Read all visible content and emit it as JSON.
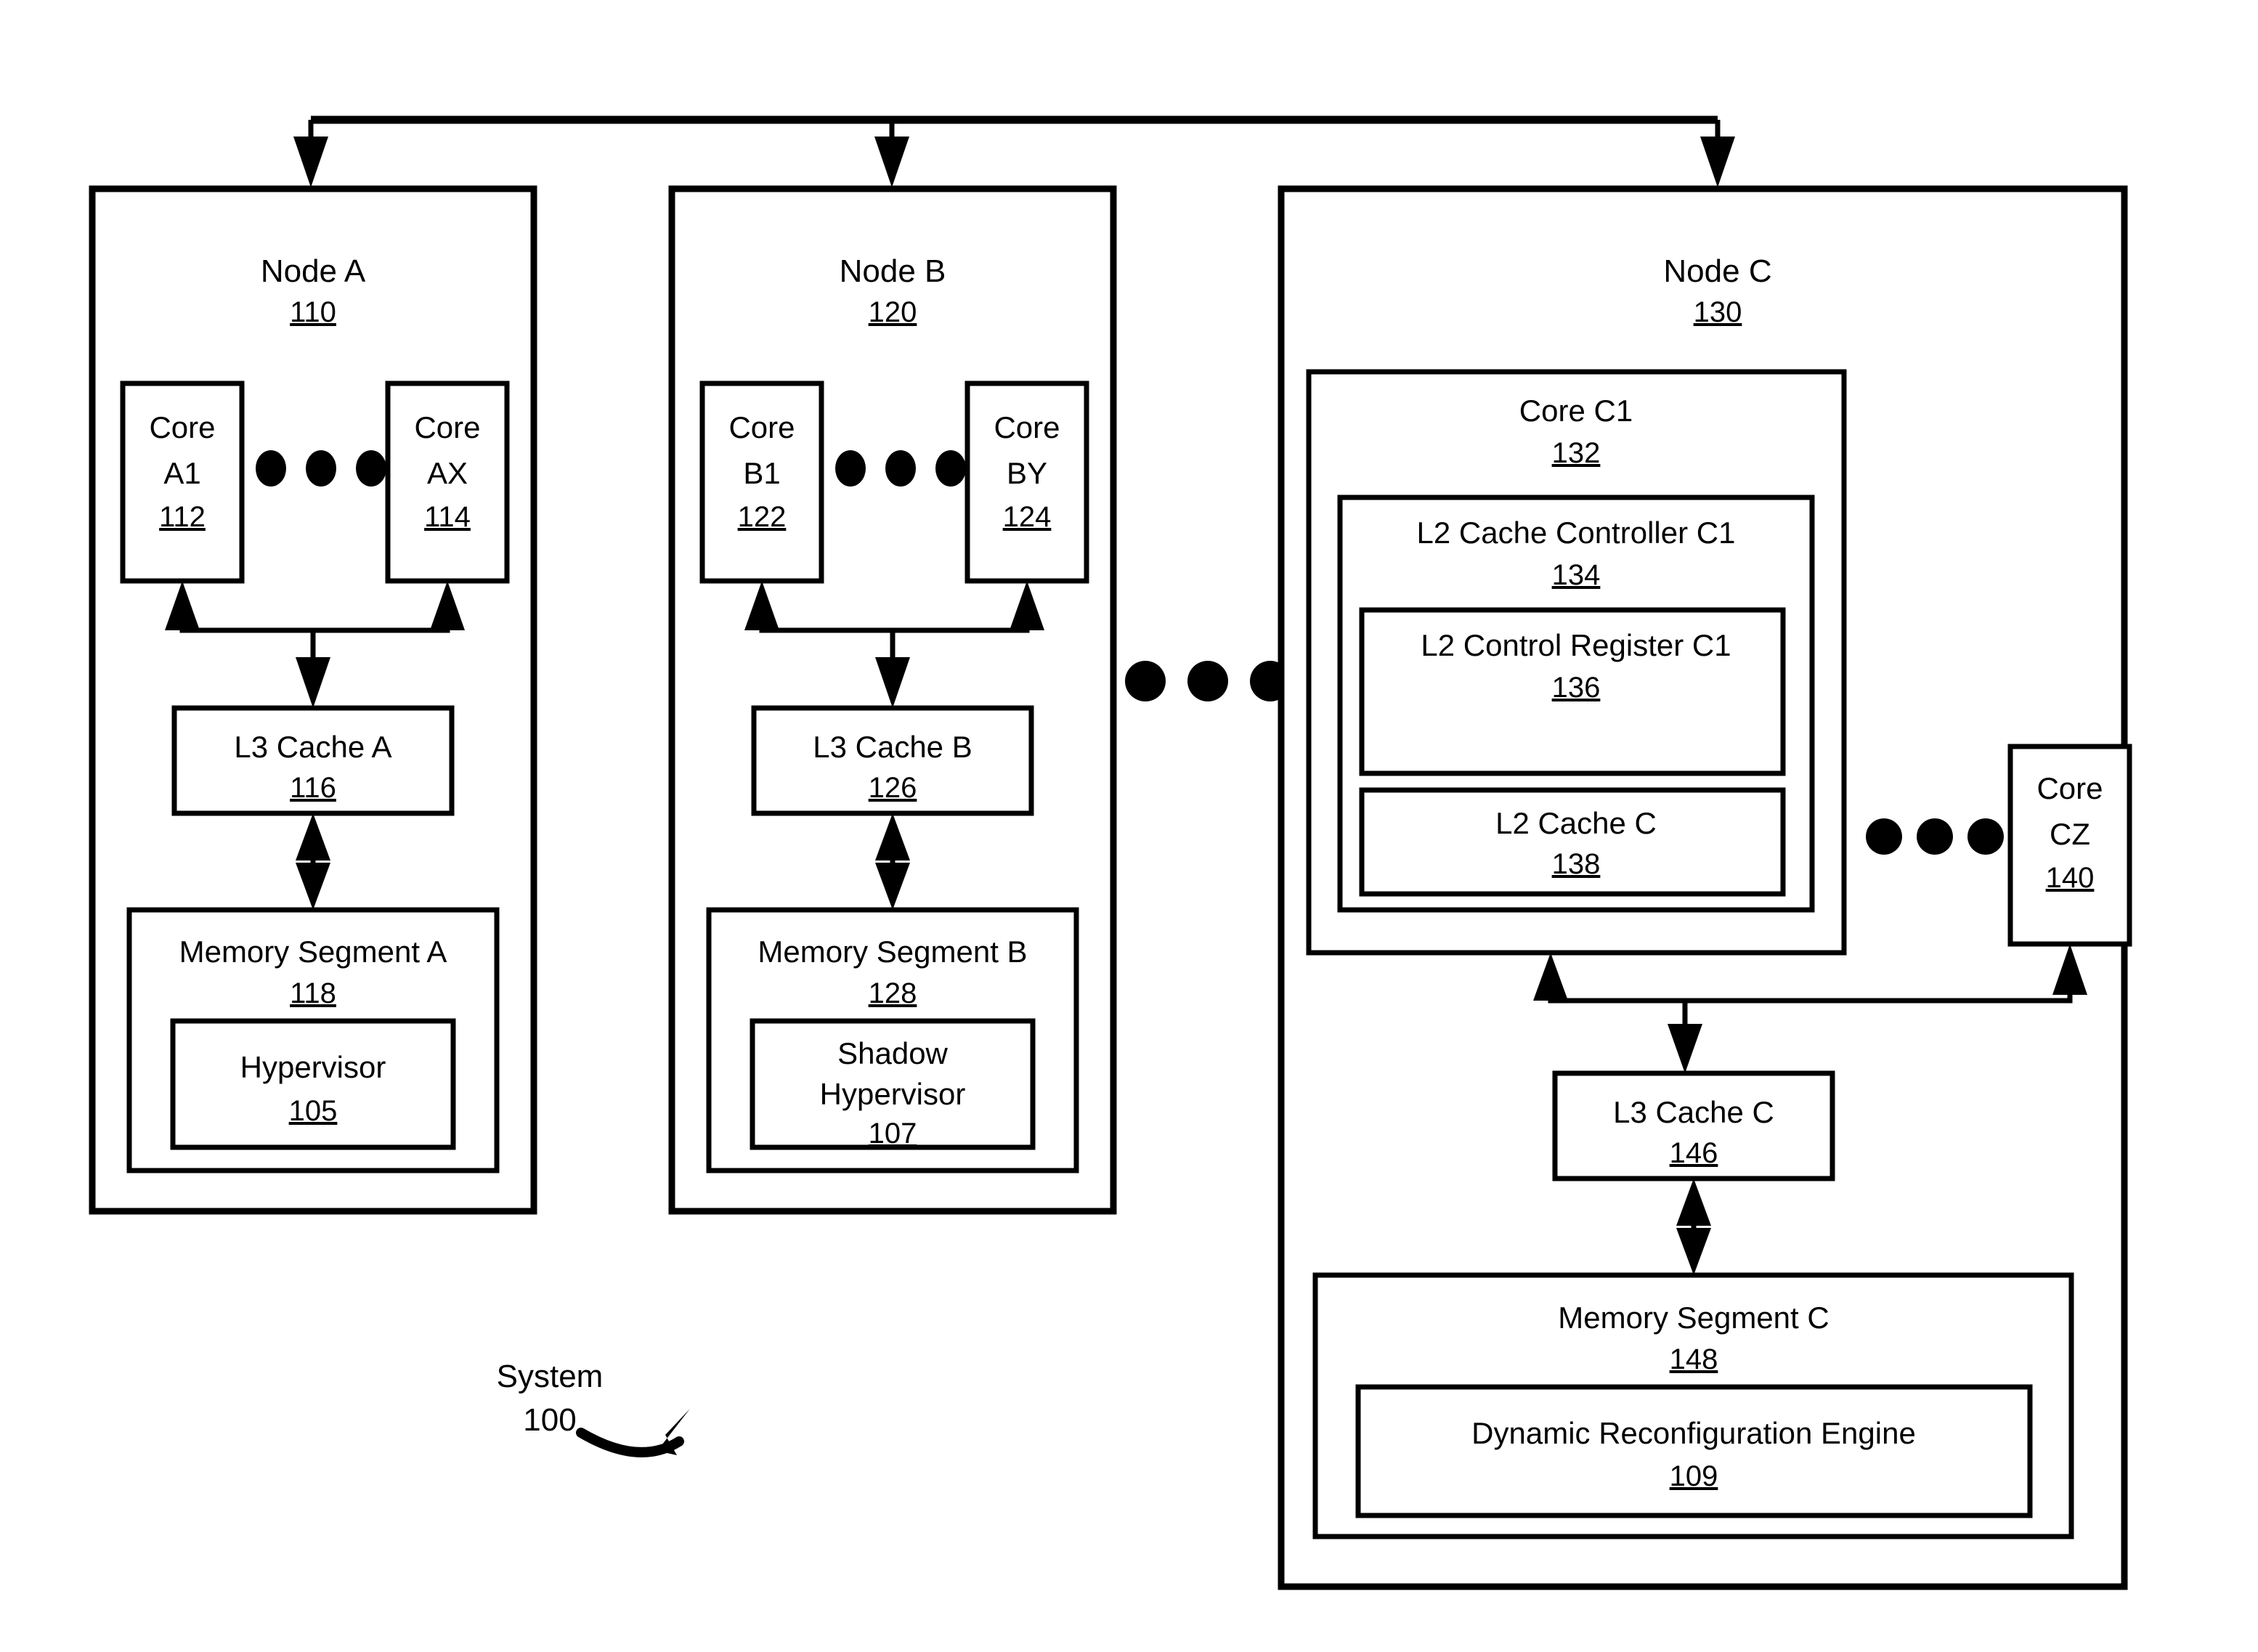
{
  "figure": {
    "system_label": "System",
    "system_number": "100"
  },
  "nodes": [
    {
      "id": "node-a",
      "title": "Node A",
      "number": "110",
      "cores": [
        {
          "line1": "Core",
          "line2": "A1",
          "number": "112"
        },
        {
          "line1": "Core",
          "line2": "AX",
          "number": "114"
        }
      ],
      "l3": {
        "title": "L3 Cache A",
        "number": "116"
      },
      "memory": {
        "title": "Memory Segment A",
        "number": "118"
      },
      "inner": {
        "line1": "Hypervisor",
        "line2": "",
        "number": "105"
      }
    },
    {
      "id": "node-b",
      "title": "Node B",
      "number": "120",
      "cores": [
        {
          "line1": "Core",
          "line2": "B1",
          "number": "122"
        },
        {
          "line1": "Core",
          "line2": "BY",
          "number": "124"
        }
      ],
      "l3": {
        "title": "L3 Cache B",
        "number": "126"
      },
      "memory": {
        "title": "Memory Segment B",
        "number": "128"
      },
      "inner": {
        "line1": "Shadow",
        "line2": "Hypervisor",
        "number": "107"
      }
    },
    {
      "id": "node-c",
      "title": "Node C",
      "number": "130",
      "core_c1": {
        "title": "Core C1",
        "number": "132"
      },
      "l2_controller": {
        "title": "L2 Cache Controller C1",
        "number": "134"
      },
      "l2_control_register": {
        "title": "L2 Control Register C1",
        "number": "136"
      },
      "l2_cache": {
        "title": "L2 Cache C",
        "number": "138"
      },
      "core_cz": {
        "line1": "Core",
        "line2": "CZ",
        "number": "140"
      },
      "l3": {
        "title": "L3 Cache C",
        "number": "146"
      },
      "memory": {
        "title": "Memory Segment C",
        "number": "148"
      },
      "engine": {
        "title": "Dynamic Reconfiguration Engine",
        "number": "109"
      }
    }
  ],
  "ellipses": {
    "node_a_cores": "•••",
    "node_b_cores": "•••",
    "between_nodes": "•••",
    "node_c_cores": "•••"
  },
  "colors": {
    "stroke": "#000000",
    "background": "#ffffff"
  }
}
